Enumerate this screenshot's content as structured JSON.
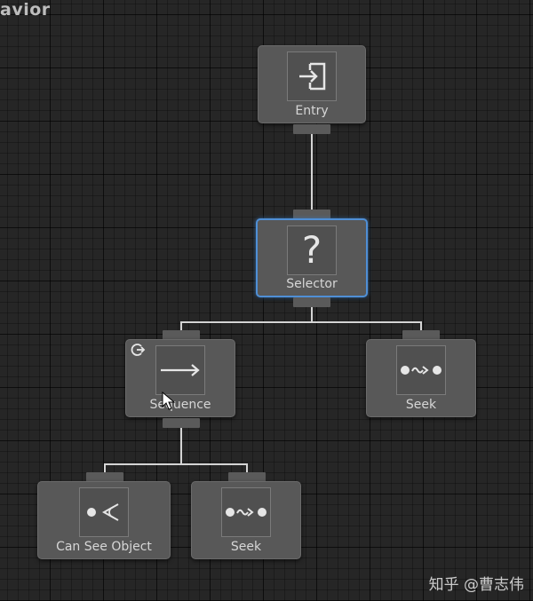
{
  "window": {
    "title": "avior"
  },
  "nodes": {
    "entry": {
      "label": "Entry",
      "icon": "entry-icon"
    },
    "selector": {
      "label": "Selector",
      "icon": "question-mark-icon",
      "glyph": "?"
    },
    "sequence": {
      "label": "Sequence",
      "icon": "arrow-right-icon",
      "decorator_icon": "repeat-icon"
    },
    "seek_right": {
      "label": "Seek",
      "icon": "seek-icon"
    },
    "can_see_object": {
      "label": "Can See Object",
      "icon": "eye-cone-icon"
    },
    "seek_bottom": {
      "label": "Seek",
      "icon": "seek-icon"
    }
  },
  "colors": {
    "selection": "#4f8fd6",
    "node": "#585858",
    "link": "#d4d4d4"
  },
  "watermark": "知乎 @曹志伟"
}
